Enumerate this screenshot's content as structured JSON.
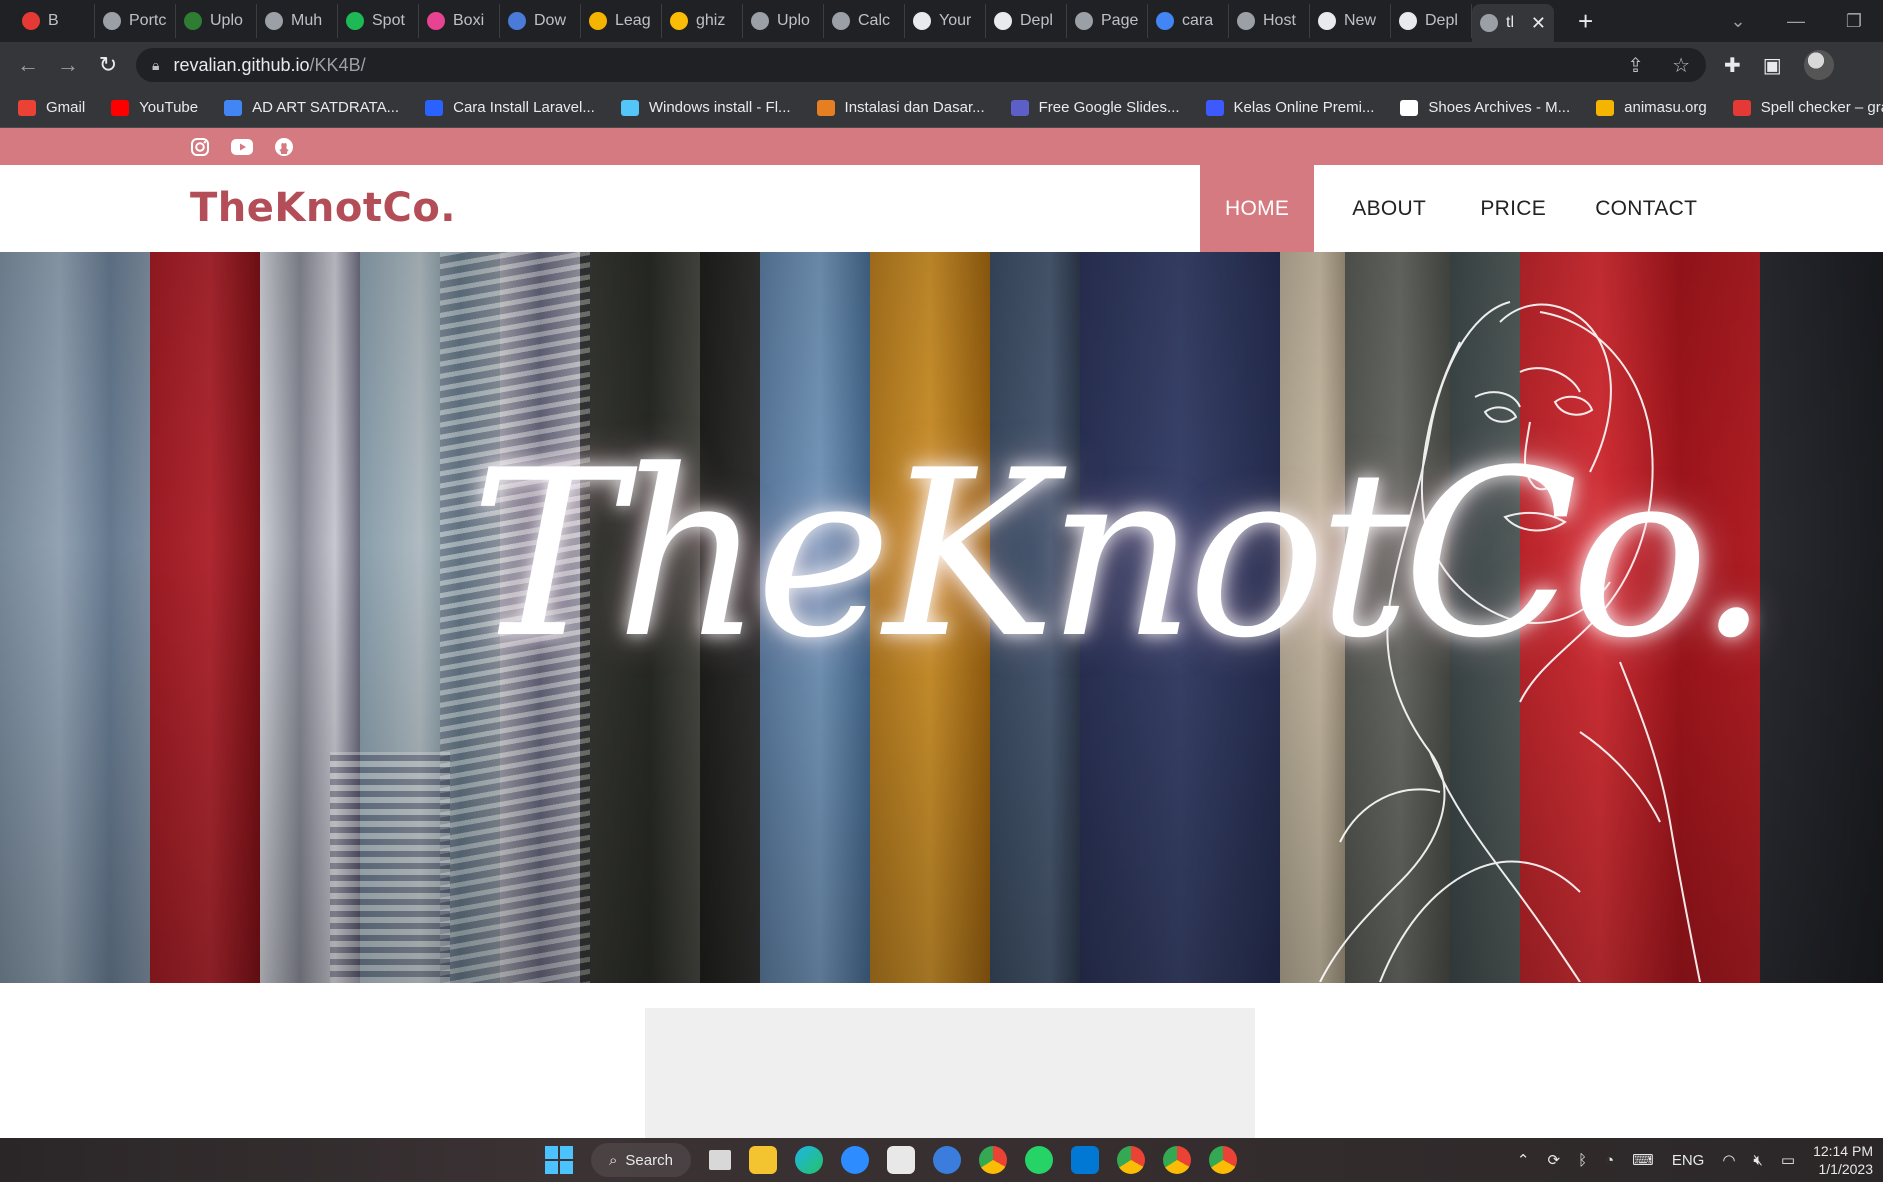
{
  "browser": {
    "tabs": [
      {
        "label": "B",
        "color": "#e53935"
      },
      {
        "label": "Portc",
        "color": "#9aa0a6"
      },
      {
        "label": "Uplo",
        "color": "#2e7d32"
      },
      {
        "label": "Muh",
        "color": "#9aa0a6"
      },
      {
        "label": "Spot",
        "color": "#1db954"
      },
      {
        "label": "Boxi",
        "color": "#e84393"
      },
      {
        "label": "Dow",
        "color": "#4a7bd9"
      },
      {
        "label": "Leag",
        "color": "#f4b400"
      },
      {
        "label": "ghiz",
        "color": "#fbbc05"
      },
      {
        "label": "Uplo",
        "color": "#9aa0a6"
      },
      {
        "label": "Calc",
        "color": "#9aa0a6"
      },
      {
        "label": "Your",
        "color": "#e8eaed"
      },
      {
        "label": "Depl",
        "color": "#e8eaed"
      },
      {
        "label": "Page",
        "color": "#9aa0a6"
      },
      {
        "label": "cara",
        "color": "#4285f4"
      },
      {
        "label": "Host",
        "color": "#9aa0a6"
      },
      {
        "label": "New",
        "color": "#e8eaed"
      },
      {
        "label": "Depl",
        "color": "#e8eaed"
      }
    ],
    "active_tab": {
      "label": "tl",
      "close": "✕"
    },
    "new_tab": "+",
    "url_host": "revalian.github.io",
    "url_path": "/KK4B/",
    "bookmarks": [
      {
        "label": "Gmail",
        "color": "#ea4335"
      },
      {
        "label": "YouTube",
        "color": "#ff0000"
      },
      {
        "label": "AD ART SATDRATA...",
        "color": "#4285f4"
      },
      {
        "label": "Cara Install Laravel...",
        "color": "#2962ff"
      },
      {
        "label": "Windows install - Fl...",
        "color": "#54c5f8"
      },
      {
        "label": "Instalasi dan Dasar...",
        "color": "#e67e22"
      },
      {
        "label": "Free Google Slides...",
        "color": "#5b5fc7"
      },
      {
        "label": "Kelas Online Premi...",
        "color": "#3d5afe"
      },
      {
        "label": "Shoes Archives - M...",
        "color": "#ffffff"
      },
      {
        "label": "animasu.org",
        "color": "#f4b400"
      },
      {
        "label": "Spell checker – gra...",
        "color": "#e53935"
      }
    ]
  },
  "site": {
    "brand": "TheKnotCo.",
    "accent": "#d47a80",
    "brand_color": "#b34d57",
    "nav": {
      "home": "HOME",
      "about": "ABOUT",
      "price": "PRICE",
      "contact": "CONTACT"
    },
    "social": [
      "instagram-icon",
      "youtube-icon",
      "github-icon"
    ],
    "hero_script": "TheKnotCo."
  },
  "taskbar": {
    "search": "Search",
    "lang": "ENG",
    "time": "12:14 PM",
    "date": "1/1/2023"
  }
}
